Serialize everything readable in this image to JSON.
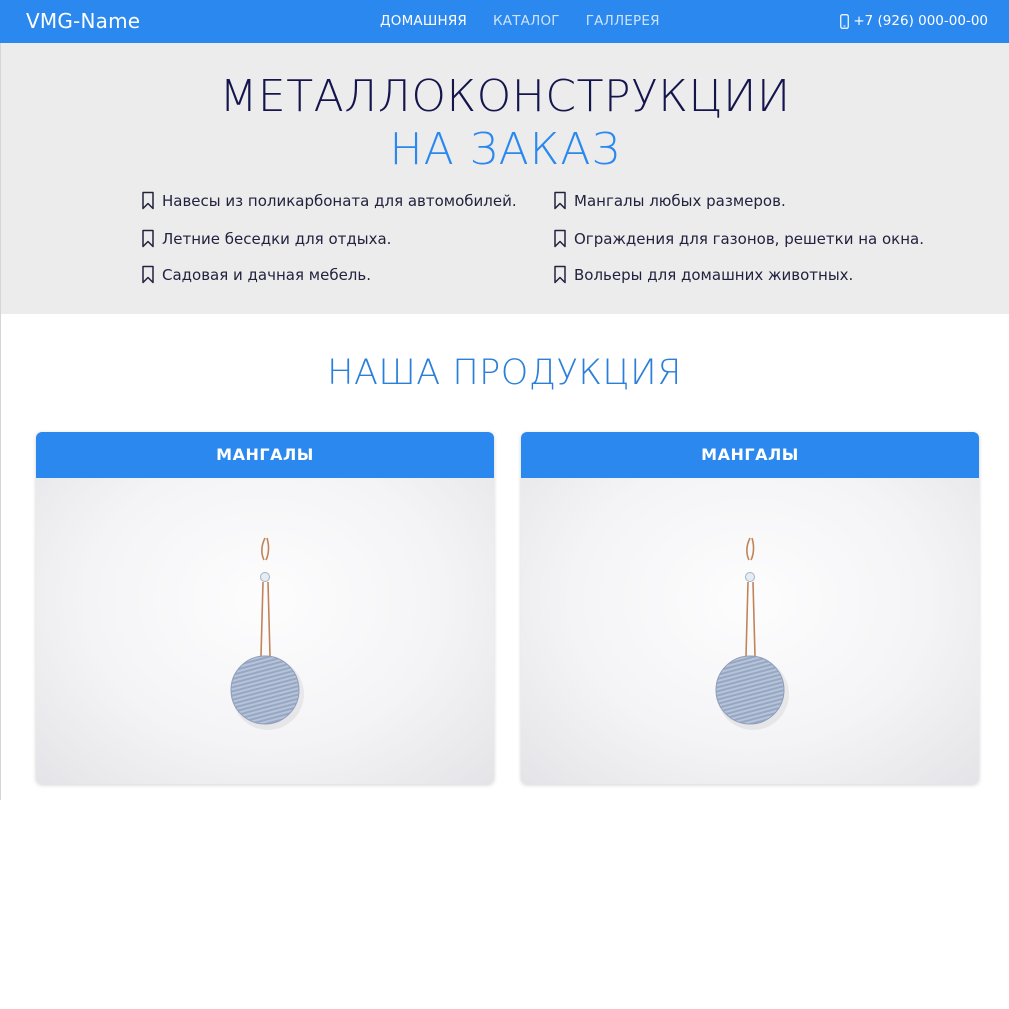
{
  "header": {
    "brand": "VMG-Name",
    "nav": [
      {
        "label": "ДОМАШНЯЯ",
        "active": true
      },
      {
        "label": "КАТАЛОГ",
        "active": false
      },
      {
        "label": "ГАЛЛЕРЕЯ",
        "active": false
      }
    ],
    "phone": "+7 (926) 000-00-00",
    "phone_icon": "mobile-phone-icon"
  },
  "hero": {
    "title": "МЕТАЛЛОКОНСТРУКЦИИ",
    "subtitle": "НА ЗАКАЗ",
    "features": [
      "Навесы из поликарбоната для автомобилей.",
      "Летние беседки для отдыха.",
      "Садовая и дачная мебель.",
      "Мангалы любых размеров.",
      "Ограждения для газонов, решетки на окна.",
      "Вольеры для домашних животных."
    ],
    "feature_icon": "bookmark-icon"
  },
  "products": {
    "title": "НАША ПРОДУКЦИЯ",
    "cards": [
      {
        "title": "МАНГАЛЫ",
        "image": "hanging-round-pendant-photo"
      },
      {
        "title": "МАНГАЛЫ",
        "image": "hanging-round-pendant-photo"
      }
    ]
  },
  "colors": {
    "primary": "#2a88ef",
    "hero_bg": "#ececed",
    "title_dark": "#15154d"
  }
}
